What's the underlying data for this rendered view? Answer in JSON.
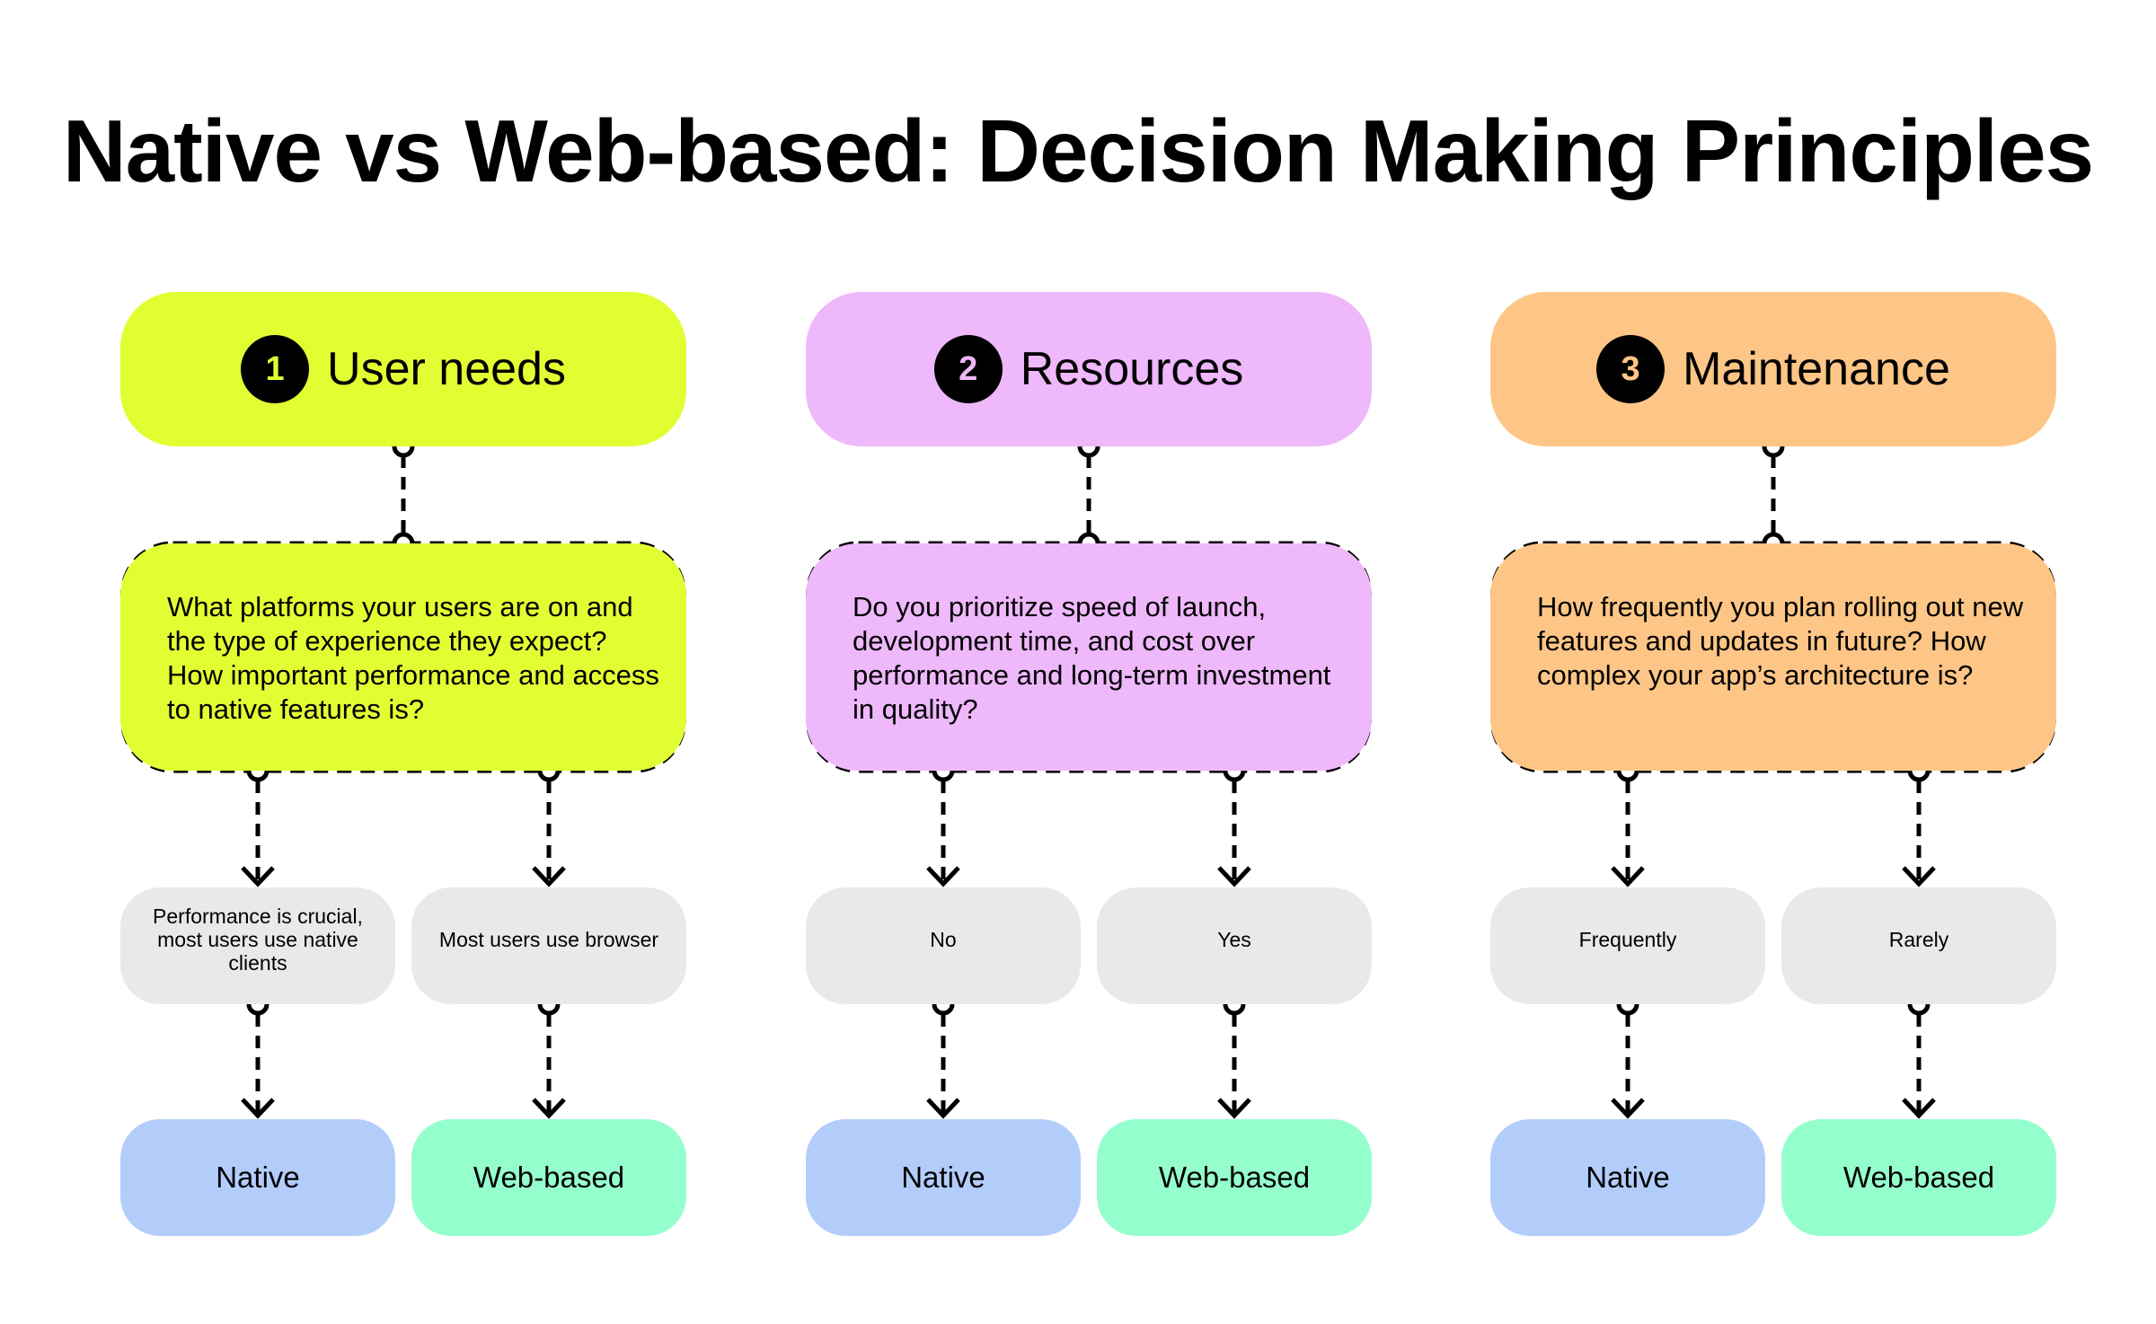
{
  "title": "Native vs Web-based: Decision Making Principles",
  "colors": {
    "user_needs": "#e1fe33",
    "resources": "#efb8fb",
    "maintenance": "#fec686",
    "option": "#e9e9e9",
    "native": "#b3cdfb",
    "web_based": "#95fecd",
    "ink": "#000000"
  },
  "columns": [
    {
      "number": "1",
      "label": "User needs",
      "color_key": "user_needs",
      "question": "What platforms your users are on and the type of experience they expect? How important performance and access to native features is?",
      "options": [
        {
          "label": "Performance is crucial, most users use native clients",
          "result": "Native"
        },
        {
          "label": "Most users use browser",
          "result": "Web-based"
        }
      ]
    },
    {
      "number": "2",
      "label": "Resources",
      "color_key": "resources",
      "question": "Do you prioritize speed of launch, development time, and cost over performance and long-term investment in quality?",
      "options": [
        {
          "label": "No",
          "result": "Native"
        },
        {
          "label": "Yes",
          "result": "Web-based"
        }
      ]
    },
    {
      "number": "3",
      "label": "Maintenance",
      "color_key": "maintenance",
      "question": "How frequently you plan rolling out new features and updates in future? How complex your app’s architecture is?",
      "options": [
        {
          "label": "Frequently",
          "result": "Native"
        },
        {
          "label": "Rarely",
          "result": "Web-based"
        }
      ]
    }
  ]
}
